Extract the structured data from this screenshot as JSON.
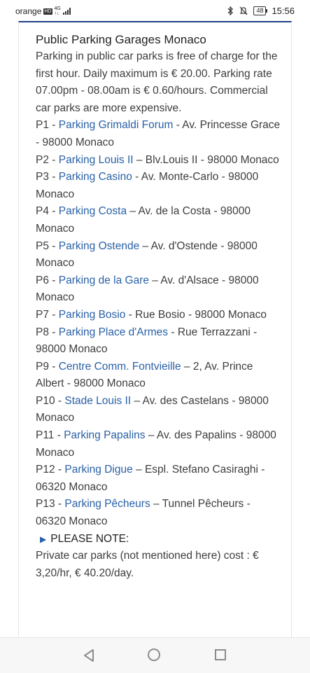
{
  "status_bar": {
    "carrier": "orange",
    "hd_badge": "HD",
    "network": "4G",
    "network_sub": "↑↓",
    "battery": "48",
    "time": "15:56"
  },
  "article": {
    "title": "Public Parking Garages Monaco",
    "intro": "Parking in public car parks is free of charge for the first hour. Daily maximum is € 20.00. Parking rate 07.00pm - 08.00am is € 0.60/hours. Commercial car parks are more expensive.",
    "items": [
      {
        "code": "P1 - ",
        "name": "Parking Grimaldi Forum",
        "address": " - Av. Princesse Grace - 98000 Monaco"
      },
      {
        "code": "P2 - ",
        "name": "Parking Louis II",
        "address": " – Blv.Louis II - 98000 Monaco"
      },
      {
        "code": "P3 - ",
        "name": "Parking Casino",
        "address": " - Av. Monte-Carlo - 98000 Monaco"
      },
      {
        "code": "P4 - ",
        "name": "Parking Costa",
        "address": " – Av. de la Costa - 98000 Monaco"
      },
      {
        "code": "P5 - ",
        "name": "Parking Ostende",
        "address": " – Av. d'Ostende - 98000 Monaco"
      },
      {
        "code": "P6 - ",
        "name": "Parking de la Gare",
        "address": " – Av. d'Alsace - 98000 Monaco"
      },
      {
        "code": "P7 - ",
        "name": "Parking Bosio",
        "address": " - Rue Bosio - 98000 Monaco"
      },
      {
        "code": "P8 - ",
        "name": "Parking Place d'Armes",
        "address": " - Rue Terrazzani - 98000 Monaco"
      },
      {
        "code": "P9 - ",
        "name": "Centre Comm. Fontvieille",
        "address": " – 2, Av. Prince Albert - 98000 Monaco"
      },
      {
        "code": "P10 - ",
        "name": "Stade Louis II",
        "address": " – Av. des Castelans - 98000 Monaco"
      },
      {
        "code": "P11 - ",
        "name": "Parking Papalins",
        "address": " – Av. des Papalins - 98000 Monaco"
      },
      {
        "code": "P12 - ",
        "name": "Parking Digue",
        "address": " – Espl. Stefano Casiraghi - 06320 Monaco"
      },
      {
        "code": "P13 - ",
        "name": "Parking Pêcheurs",
        "address": " – Tunnel Pêcheurs - 06320 Monaco"
      }
    ],
    "note_heading": "PLEASE NOTE:",
    "note_text": "Private car parks (not mentioned here) cost : € 3,20/hr, € 40.20/day."
  },
  "nav_bar": {
    "back_icon": "triangle-back-icon",
    "home_icon": "circle-home-icon",
    "recent_icon": "square-recents-icon"
  }
}
